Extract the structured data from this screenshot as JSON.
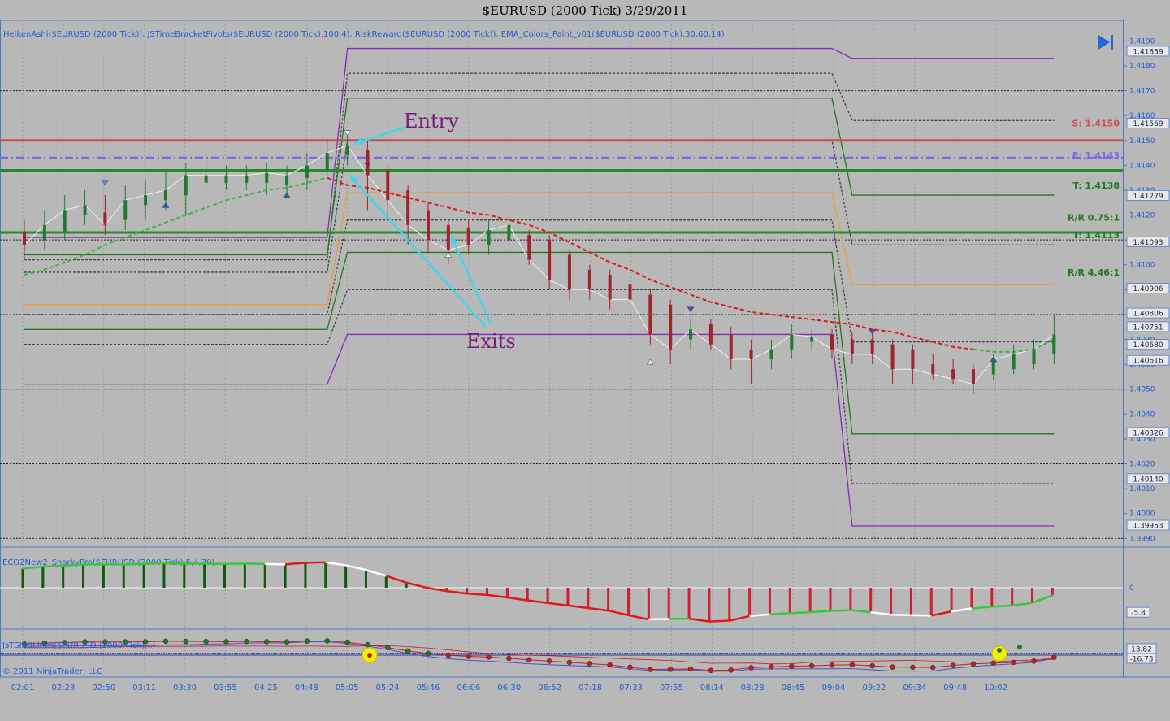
{
  "title": "$EURUSD (2000 Tick)  3/29/2011",
  "indicator_text": "HeikenAshi($EURUSD (2000 Tick)), JSTimeBracketPivots($EURUSD (2000 Tick),100,4), RiskReward($EURUSD (2000 Tick)), EMA_Colors_Paint_v01($EURUSD (2000 Tick),30,60,14)",
  "panel2_label": "ECO2New2_SharkyPro($EURUSD (2000 Tick),5,4,30)",
  "panel3_label": "JsTSIBBLines($EURUSD (2000 Tick),..)",
  "copyright": "© 2011 NinjaTrader, LLC",
  "annotations": {
    "entry": "Entry",
    "exits": "Exits"
  },
  "rr_labels": {
    "stop": "S: 1.4150",
    "entry": "E: 1.4143",
    "target1": "T: 1.4138",
    "rr1": "R/R 0.75:1",
    "target2": "T: 1.4113",
    "rr2": "R/R 4.46:1"
  },
  "colors": {
    "background": "#b8b8b8",
    "axis_text": "#1e5fd6",
    "up_candle": "#1f7a2f",
    "down_candle": "#a0252a",
    "ema_red": "#e01818",
    "ema_green": "#3ab83a",
    "stop_line": "#c85050",
    "entry_line": "#7a6ae8",
    "target_line": "#2a8a2a",
    "pivot_purple": "#8a2ab8",
    "pivot_green": "#1e7a1e",
    "pivot_orange": "#e8a030",
    "annotation_text": "#7a1a7a",
    "arrow": "#40d8e8",
    "osc_pos": "#0e5a0e",
    "osc_neg": "#d02030"
  },
  "chart_data": {
    "type": "candlestick",
    "title": "$EURUSD (2000 Tick)  3/29/2011",
    "x_ticks": [
      "02:01",
      "02:23",
      "02:50",
      "03:11",
      "03:30",
      "03:55",
      "04:25",
      "04:48",
      "05:05",
      "05:24",
      "05:46",
      "06:06",
      "06:30",
      "06:52",
      "07:18",
      "07:33",
      "07:55",
      "08:14",
      "08:28",
      "08:45",
      "09:04",
      "09:22",
      "09:34",
      "09:48",
      "10:02"
    ],
    "y_ticks": [
      1.419,
      1.418,
      1.417,
      1.416,
      1.415,
      1.414,
      1.413,
      1.412,
      1.411,
      1.41,
      1.409,
      1.408,
      1.407,
      1.406,
      1.405,
      1.404,
      1.403,
      1.402,
      1.401,
      1.4,
      1.399
    ],
    "ylim": [
      1.39865,
      1.41983
    ],
    "price_boxes": [
      1.41859,
      1.41569,
      1.41279,
      1.41093,
      1.40906,
      1.40806,
      1.40751,
      1.4068,
      1.40616,
      1.40326,
      1.4014,
      1.39953
    ],
    "candles": [
      {
        "o": 1.4113,
        "c": 1.4108,
        "h": 1.4118,
        "l": 1.4102
      },
      {
        "o": 1.411,
        "c": 1.4116,
        "h": 1.4122,
        "l": 1.4106
      },
      {
        "o": 1.4113,
        "c": 1.4122,
        "h": 1.4128,
        "l": 1.411
      },
      {
        "o": 1.412,
        "c": 1.4124,
        "h": 1.413,
        "l": 1.4116
      },
      {
        "o": 1.4121,
        "c": 1.4116,
        "h": 1.4128,
        "l": 1.4112
      },
      {
        "o": 1.4118,
        "c": 1.4126,
        "h": 1.4132,
        "l": 1.4114
      },
      {
        "o": 1.4124,
        "c": 1.4128,
        "h": 1.4134,
        "l": 1.4118
      },
      {
        "o": 1.4126,
        "c": 1.413,
        "h": 1.4138,
        "l": 1.4122
      },
      {
        "o": 1.4128,
        "c": 1.4136,
        "h": 1.4141,
        "l": 1.412
      },
      {
        "o": 1.4133,
        "c": 1.4136,
        "h": 1.4142,
        "l": 1.413
      },
      {
        "o": 1.4133,
        "c": 1.4136,
        "h": 1.414,
        "l": 1.413
      },
      {
        "o": 1.4133,
        "c": 1.4136,
        "h": 1.414,
        "l": 1.413
      },
      {
        "o": 1.4133,
        "c": 1.4137,
        "h": 1.4141,
        "l": 1.4128
      },
      {
        "o": 1.4132,
        "c": 1.4136,
        "h": 1.414,
        "l": 1.4128
      },
      {
        "o": 1.4135,
        "c": 1.414,
        "h": 1.4145,
        "l": 1.413
      },
      {
        "o": 1.4138,
        "c": 1.4145,
        "h": 1.415,
        "l": 1.4136
      },
      {
        "o": 1.4144,
        "c": 1.4148,
        "h": 1.4152,
        "l": 1.414
      },
      {
        "o": 1.4146,
        "c": 1.4136,
        "h": 1.415,
        "l": 1.4122
      },
      {
        "o": 1.4138,
        "c": 1.4126,
        "h": 1.414,
        "l": 1.4118
      },
      {
        "o": 1.413,
        "c": 1.4116,
        "h": 1.4132,
        "l": 1.4108
      },
      {
        "o": 1.4122,
        "c": 1.411,
        "h": 1.4125,
        "l": 1.4105
      },
      {
        "o": 1.4116,
        "c": 1.4106,
        "h": 1.4118,
        "l": 1.41
      },
      {
        "o": 1.4115,
        "c": 1.4108,
        "h": 1.4118,
        "l": 1.4104
      },
      {
        "o": 1.4108,
        "c": 1.4114,
        "h": 1.4118,
        "l": 1.4104
      },
      {
        "o": 1.411,
        "c": 1.4116,
        "h": 1.412,
        "l": 1.4108
      },
      {
        "o": 1.4112,
        "c": 1.4102,
        "h": 1.4114,
        "l": 1.41
      },
      {
        "o": 1.411,
        "c": 1.4094,
        "h": 1.4112,
        "l": 1.409
      },
      {
        "o": 1.4104,
        "c": 1.409,
        "h": 1.4106,
        "l": 1.4086
      },
      {
        "o": 1.4098,
        "c": 1.409,
        "h": 1.41,
        "l": 1.4086
      },
      {
        "o": 1.4096,
        "c": 1.4086,
        "h": 1.4098,
        "l": 1.4082
      },
      {
        "o": 1.4092,
        "c": 1.4086,
        "h": 1.4096,
        "l": 1.4084
      },
      {
        "o": 1.4088,
        "c": 1.4072,
        "h": 1.409,
        "l": 1.4068
      },
      {
        "o": 1.4084,
        "c": 1.4066,
        "h": 1.4086,
        "l": 1.406
      },
      {
        "o": 1.407,
        "c": 1.4074,
        "h": 1.4078,
        "l": 1.4066
      },
      {
        "o": 1.4076,
        "c": 1.4068,
        "h": 1.4078,
        "l": 1.4066
      },
      {
        "o": 1.4072,
        "c": 1.4062,
        "h": 1.4075,
        "l": 1.4058
      },
      {
        "o": 1.4066,
        "c": 1.4062,
        "h": 1.407,
        "l": 1.4052
      },
      {
        "o": 1.4062,
        "c": 1.4066,
        "h": 1.407,
        "l": 1.4058
      },
      {
        "o": 1.4066,
        "c": 1.4072,
        "h": 1.4076,
        "l": 1.4062
      },
      {
        "o": 1.4069,
        "c": 1.4071,
        "h": 1.4074,
        "l": 1.4066
      },
      {
        "o": 1.4072,
        "c": 1.4066,
        "h": 1.4074,
        "l": 1.4062
      },
      {
        "o": 1.407,
        "c": 1.4064,
        "h": 1.4073,
        "l": 1.406
      },
      {
        "o": 1.407,
        "c": 1.4064,
        "h": 1.4074,
        "l": 1.406
      },
      {
        "o": 1.4068,
        "c": 1.4058,
        "h": 1.407,
        "l": 1.4052
      },
      {
        "o": 1.4066,
        "c": 1.4058,
        "h": 1.4068,
        "l": 1.4052
      },
      {
        "o": 1.406,
        "c": 1.4056,
        "h": 1.4064,
        "l": 1.4054
      },
      {
        "o": 1.4058,
        "c": 1.4054,
        "h": 1.4062,
        "l": 1.4052
      },
      {
        "o": 1.4058,
        "c": 1.4052,
        "h": 1.406,
        "l": 1.4048
      },
      {
        "o": 1.4056,
        "c": 1.4062,
        "h": 1.4064,
        "l": 1.4054
      },
      {
        "o": 1.4058,
        "c": 1.4064,
        "h": 1.4068,
        "l": 1.4056
      },
      {
        "o": 1.406,
        "c": 1.4066,
        "h": 1.407,
        "l": 1.4058
      },
      {
        "o": 1.4064,
        "c": 1.4072,
        "h": 1.408,
        "l": 1.406
      }
    ],
    "ema_fast": [
      1.4096,
      1.4098,
      1.4101,
      1.4104,
      1.4108,
      1.4111,
      1.4114,
      1.4117,
      1.412,
      1.4123,
      1.4126,
      1.4128,
      1.413,
      1.4131,
      1.4133,
      1.4135,
      1.4132,
      1.4131,
      1.4129,
      1.4127,
      1.4125,
      1.4123,
      1.4121,
      1.412,
      1.4118,
      1.4116,
      1.4113,
      1.4109,
      1.4105,
      1.4101,
      1.4098,
      1.4094,
      1.4091,
      1.4088,
      1.4085,
      1.4083,
      1.4081,
      1.408,
      1.4079,
      1.4078,
      1.4077,
      1.4076,
      1.4074,
      1.4073,
      1.4071,
      1.4069,
      1.4067,
      1.4066,
      1.4065,
      1.4065,
      1.4066,
      1.407
    ],
    "pivots": {
      "x_change_start": 15,
      "x_change_end": 16,
      "x_drop_start": 40,
      "x_drop_end": 41,
      "levels": [
        {
          "name": "purple-top",
          "color": "#8a2ab8",
          "style": "solid",
          "a": 1.4111,
          "b": 1.4187,
          "c": 1.4183,
          "d": 1.4183
        },
        {
          "name": "dash-1",
          "color": "#444444",
          "style": "dash",
          "a": 1.4102,
          "b": 1.4177,
          "c": 1.4158,
          "d": 1.4158
        },
        {
          "name": "green-1",
          "color": "#1e7a1e",
          "style": "solid",
          "a": 1.4104,
          "b": 1.4167,
          "c": 1.4128,
          "d": 1.4128
        },
        {
          "name": "dash-2",
          "color": "#444444",
          "style": "dash",
          "a": 1.4097,
          "b": 1.415,
          "c": 1.4108,
          "d": 1.4108
        },
        {
          "name": "orange-1",
          "color": "#e8a030",
          "style": "solid",
          "a": 1.4084,
          "b": 1.4129,
          "c": 1.4092,
          "d": 1.4092
        },
        {
          "name": "dash-3",
          "color": "#444444",
          "style": "dash",
          "a": 1.408,
          "b": 1.4118,
          "c": 1.4069,
          "d": 1.4069
        },
        {
          "name": "green-2",
          "color": "#1e7a1e",
          "style": "solid",
          "a": 1.4074,
          "b": 1.4105,
          "c": 1.4032,
          "d": 1.4032
        },
        {
          "name": "dash-4",
          "color": "#444444",
          "style": "dash",
          "a": 1.4068,
          "b": 1.409,
          "c": 1.4012,
          "d": 1.4012
        },
        {
          "name": "purple-bottom",
          "color": "#8a2ab8",
          "style": "solid",
          "a": 1.4052,
          "b": 1.4072,
          "c": 1.3995,
          "d": 1.3995
        }
      ]
    },
    "horizontal_lines": [
      {
        "value": 1.415,
        "color": "#c85050",
        "width": 3,
        "style": "solid"
      },
      {
        "value": 1.4143,
        "color": "#7a6ae8",
        "width": 3,
        "style": "dashdot"
      },
      {
        "value": 1.4138,
        "color": "#2a8a2a",
        "width": 3,
        "style": "solid"
      },
      {
        "value": 1.4113,
        "color": "#2a8a2a",
        "width": 3,
        "style": "solid"
      }
    ],
    "oscillator": [
      4.5,
      5,
      5.2,
      5.5,
      5.5,
      5.5,
      5.6,
      5.8,
      5.7,
      5.7,
      5.6,
      5.7,
      5.6,
      5.5,
      5.9,
      6,
      5.3,
      4.2,
      2.8,
      1.2,
      0,
      -0.8,
      -1.4,
      -1.7,
      -2.3,
      -3,
      -3.6,
      -4.2,
      -4.8,
      -5.4,
      -6.5,
      -7.5,
      -7.4,
      -7.3,
      -8,
      -7.8,
      -6.7,
      -6.3,
      -6,
      -5.8,
      -5.5,
      -5.3,
      -5.8,
      -6.4,
      -6.5,
      -6.6,
      -5.6,
      -4.9,
      -4.5,
      -4.2,
      -3.6,
      -1.8
    ],
    "osc_colors": [
      "g",
      "g",
      "g",
      "g",
      "g",
      "g",
      "g",
      "g",
      "g",
      "g",
      "g",
      "g",
      "w",
      "r",
      "r",
      "w",
      "w",
      "w",
      "r",
      "r",
      "r",
      "r",
      "r",
      "r",
      "r",
      "r",
      "r",
      "r",
      "r",
      "r",
      "r",
      "w",
      "g",
      "r",
      "r",
      "r",
      "w",
      "g",
      "g",
      "g",
      "g",
      "g",
      "w",
      "w",
      "w",
      "r",
      "w",
      "g",
      "g",
      "g",
      "g",
      "g"
    ],
    "osc_axis_labels": [
      "0",
      "-5.8"
    ],
    "tsi_axis_labels": [
      "13.82",
      "-16.73"
    ]
  }
}
